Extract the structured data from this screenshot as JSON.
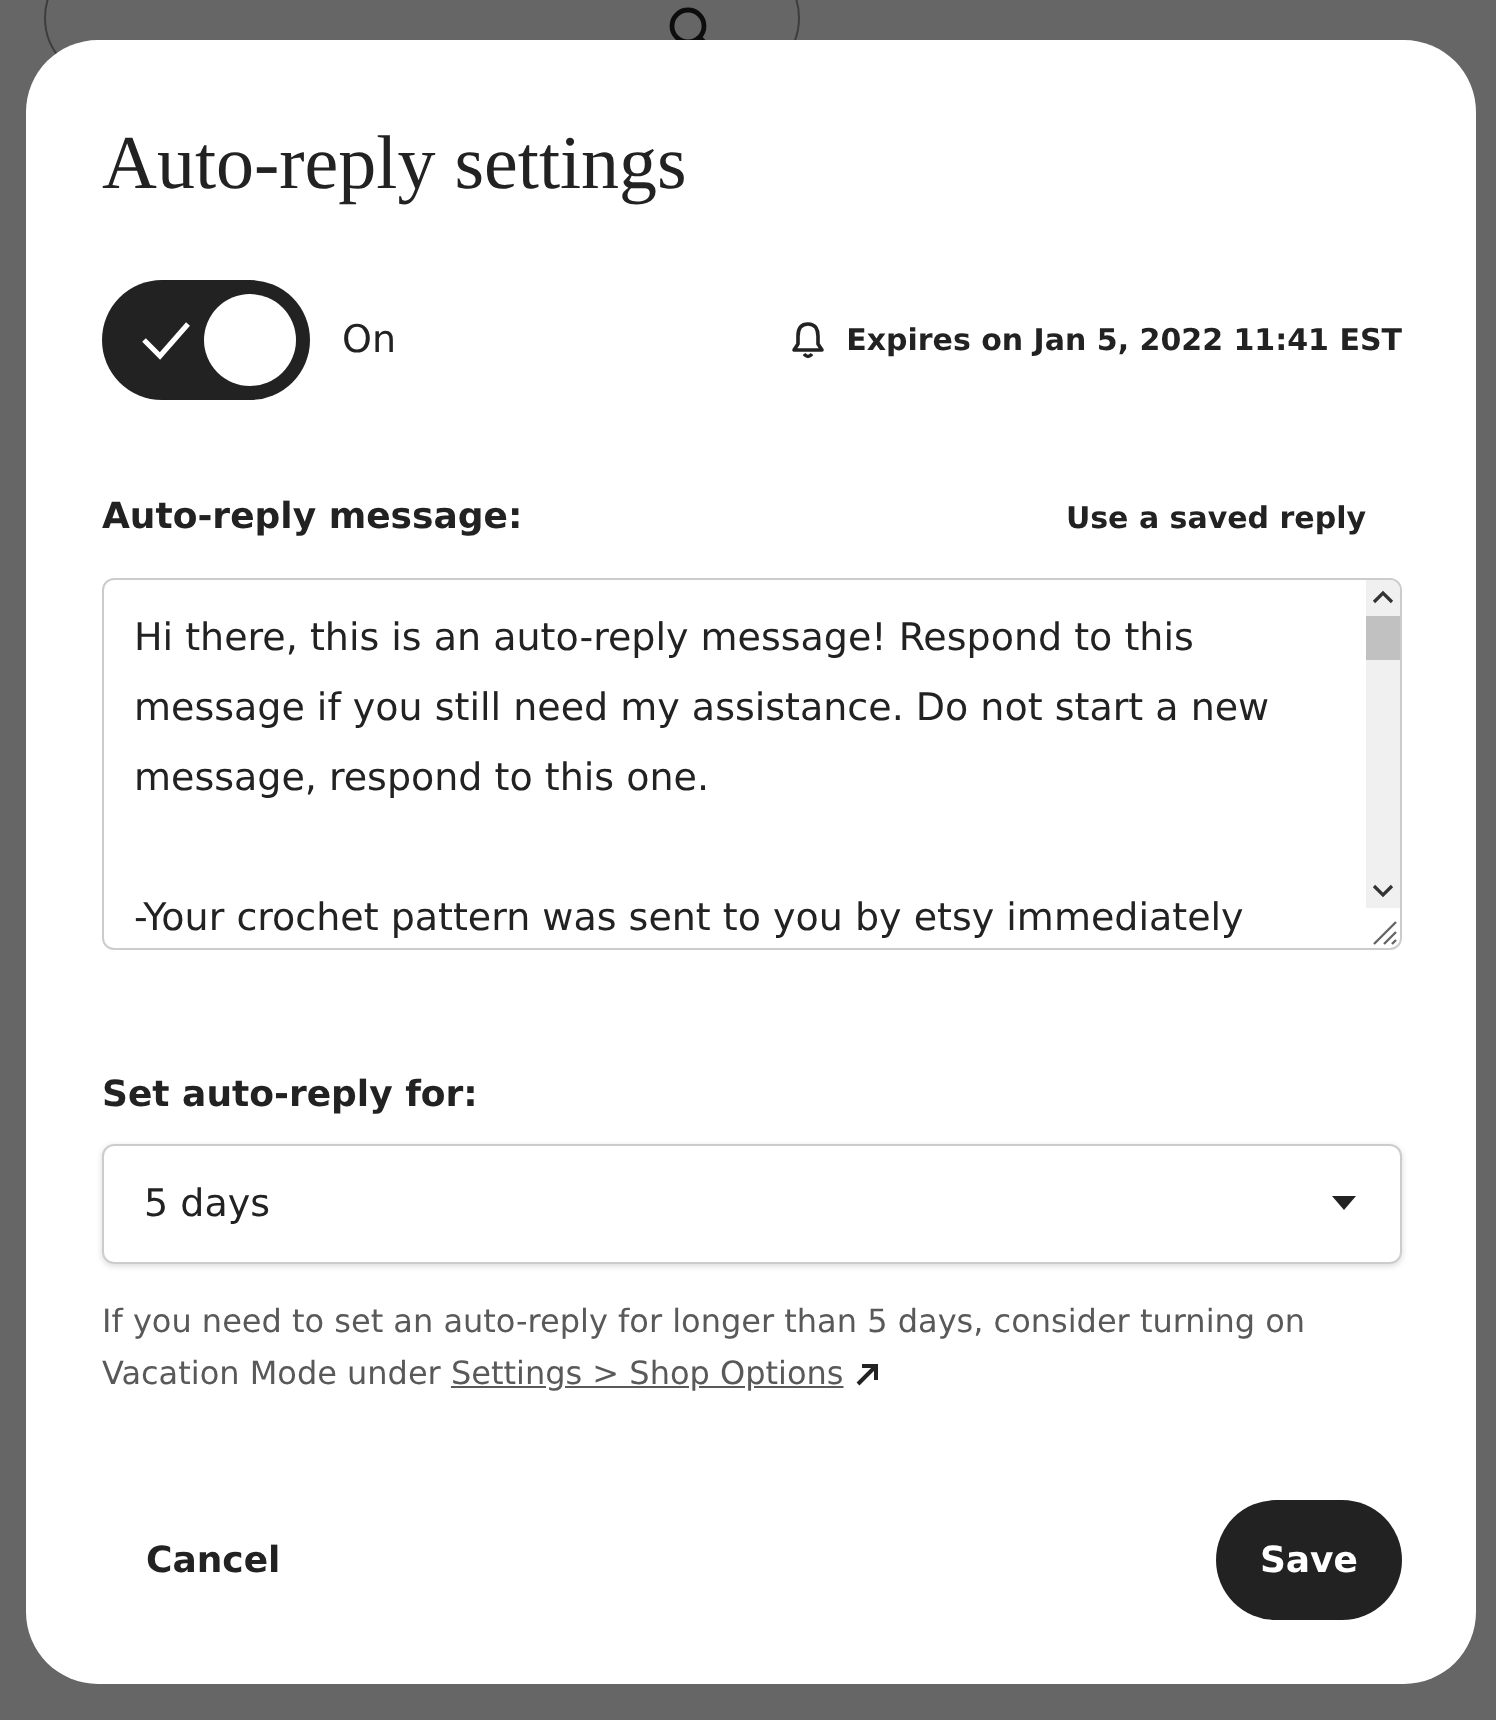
{
  "dialog": {
    "title": "Auto-reply settings",
    "toggle": {
      "on": true,
      "label": "On"
    },
    "expiry": "Expires on Jan 5, 2022 11:41 EST",
    "message_label": "Auto-reply message:",
    "saved_reply_link": "Use a saved reply",
    "message": "Hi there, this is an auto-reply message! Respond to this message if you still need my assistance. Do not start a new message, respond to this one.\n\n-Your crochet pattern was sent to you by etsy immediately",
    "duration_label": "Set auto-reply for:",
    "duration": "5 days",
    "help_text": "If you need to set an auto-reply for longer than 5 days, consider turning on Vacation Mode under",
    "help_link": "Settings > Shop Options",
    "buttons": [
      {
        "kind": "secondary",
        "label": "Cancel"
      },
      {
        "kind": "primary",
        "label": "Save"
      }
    ]
  }
}
